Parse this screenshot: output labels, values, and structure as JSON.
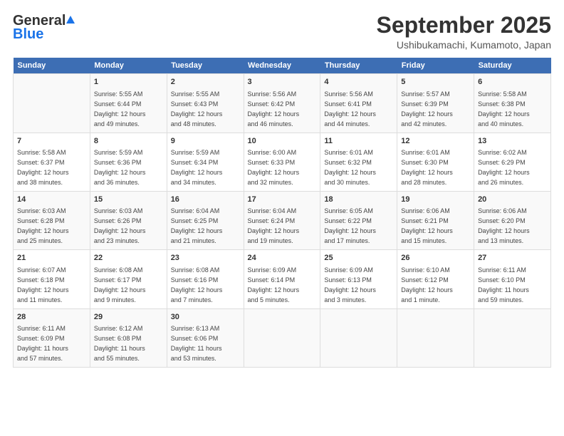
{
  "header": {
    "logo_general": "General",
    "logo_blue": "Blue",
    "month_title": "September 2025",
    "location": "Ushibukamachi, Kumamoto, Japan"
  },
  "days_of_week": [
    "Sunday",
    "Monday",
    "Tuesday",
    "Wednesday",
    "Thursday",
    "Friday",
    "Saturday"
  ],
  "weeks": [
    [
      {
        "day": "",
        "detail": ""
      },
      {
        "day": "1",
        "detail": "Sunrise: 5:55 AM\nSunset: 6:44 PM\nDaylight: 12 hours\nand 49 minutes."
      },
      {
        "day": "2",
        "detail": "Sunrise: 5:55 AM\nSunset: 6:43 PM\nDaylight: 12 hours\nand 48 minutes."
      },
      {
        "day": "3",
        "detail": "Sunrise: 5:56 AM\nSunset: 6:42 PM\nDaylight: 12 hours\nand 46 minutes."
      },
      {
        "day": "4",
        "detail": "Sunrise: 5:56 AM\nSunset: 6:41 PM\nDaylight: 12 hours\nand 44 minutes."
      },
      {
        "day": "5",
        "detail": "Sunrise: 5:57 AM\nSunset: 6:39 PM\nDaylight: 12 hours\nand 42 minutes."
      },
      {
        "day": "6",
        "detail": "Sunrise: 5:58 AM\nSunset: 6:38 PM\nDaylight: 12 hours\nand 40 minutes."
      }
    ],
    [
      {
        "day": "7",
        "detail": "Sunrise: 5:58 AM\nSunset: 6:37 PM\nDaylight: 12 hours\nand 38 minutes."
      },
      {
        "day": "8",
        "detail": "Sunrise: 5:59 AM\nSunset: 6:36 PM\nDaylight: 12 hours\nand 36 minutes."
      },
      {
        "day": "9",
        "detail": "Sunrise: 5:59 AM\nSunset: 6:34 PM\nDaylight: 12 hours\nand 34 minutes."
      },
      {
        "day": "10",
        "detail": "Sunrise: 6:00 AM\nSunset: 6:33 PM\nDaylight: 12 hours\nand 32 minutes."
      },
      {
        "day": "11",
        "detail": "Sunrise: 6:01 AM\nSunset: 6:32 PM\nDaylight: 12 hours\nand 30 minutes."
      },
      {
        "day": "12",
        "detail": "Sunrise: 6:01 AM\nSunset: 6:30 PM\nDaylight: 12 hours\nand 28 minutes."
      },
      {
        "day": "13",
        "detail": "Sunrise: 6:02 AM\nSunset: 6:29 PM\nDaylight: 12 hours\nand 26 minutes."
      }
    ],
    [
      {
        "day": "14",
        "detail": "Sunrise: 6:03 AM\nSunset: 6:28 PM\nDaylight: 12 hours\nand 25 minutes."
      },
      {
        "day": "15",
        "detail": "Sunrise: 6:03 AM\nSunset: 6:26 PM\nDaylight: 12 hours\nand 23 minutes."
      },
      {
        "day": "16",
        "detail": "Sunrise: 6:04 AM\nSunset: 6:25 PM\nDaylight: 12 hours\nand 21 minutes."
      },
      {
        "day": "17",
        "detail": "Sunrise: 6:04 AM\nSunset: 6:24 PM\nDaylight: 12 hours\nand 19 minutes."
      },
      {
        "day": "18",
        "detail": "Sunrise: 6:05 AM\nSunset: 6:22 PM\nDaylight: 12 hours\nand 17 minutes."
      },
      {
        "day": "19",
        "detail": "Sunrise: 6:06 AM\nSunset: 6:21 PM\nDaylight: 12 hours\nand 15 minutes."
      },
      {
        "day": "20",
        "detail": "Sunrise: 6:06 AM\nSunset: 6:20 PM\nDaylight: 12 hours\nand 13 minutes."
      }
    ],
    [
      {
        "day": "21",
        "detail": "Sunrise: 6:07 AM\nSunset: 6:18 PM\nDaylight: 12 hours\nand 11 minutes."
      },
      {
        "day": "22",
        "detail": "Sunrise: 6:08 AM\nSunset: 6:17 PM\nDaylight: 12 hours\nand 9 minutes."
      },
      {
        "day": "23",
        "detail": "Sunrise: 6:08 AM\nSunset: 6:16 PM\nDaylight: 12 hours\nand 7 minutes."
      },
      {
        "day": "24",
        "detail": "Sunrise: 6:09 AM\nSunset: 6:14 PM\nDaylight: 12 hours\nand 5 minutes."
      },
      {
        "day": "25",
        "detail": "Sunrise: 6:09 AM\nSunset: 6:13 PM\nDaylight: 12 hours\nand 3 minutes."
      },
      {
        "day": "26",
        "detail": "Sunrise: 6:10 AM\nSunset: 6:12 PM\nDaylight: 12 hours\nand 1 minute."
      },
      {
        "day": "27",
        "detail": "Sunrise: 6:11 AM\nSunset: 6:10 PM\nDaylight: 11 hours\nand 59 minutes."
      }
    ],
    [
      {
        "day": "28",
        "detail": "Sunrise: 6:11 AM\nSunset: 6:09 PM\nDaylight: 11 hours\nand 57 minutes."
      },
      {
        "day": "29",
        "detail": "Sunrise: 6:12 AM\nSunset: 6:08 PM\nDaylight: 11 hours\nand 55 minutes."
      },
      {
        "day": "30",
        "detail": "Sunrise: 6:13 AM\nSunset: 6:06 PM\nDaylight: 11 hours\nand 53 minutes."
      },
      {
        "day": "",
        "detail": ""
      },
      {
        "day": "",
        "detail": ""
      },
      {
        "day": "",
        "detail": ""
      },
      {
        "day": "",
        "detail": ""
      }
    ]
  ]
}
